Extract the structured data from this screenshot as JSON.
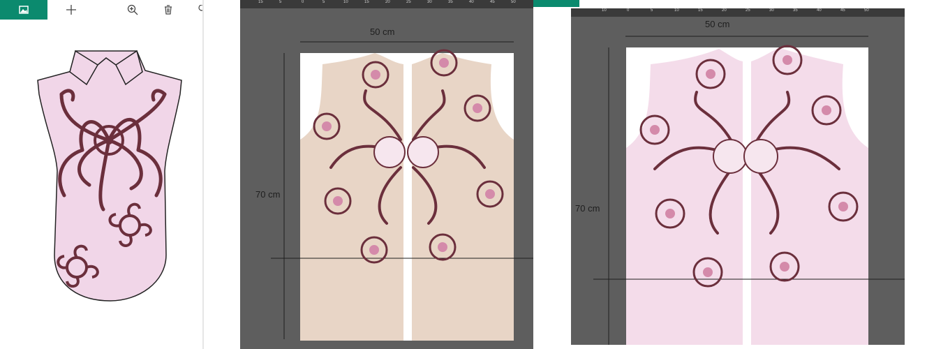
{
  "toolbar": {
    "icons": [
      "image-icon",
      "plus-icon",
      "zoom-in-icon",
      "delete-icon"
    ],
    "accent_color": "#0b8a6e"
  },
  "preview": {
    "garment_fill": "#f1d6e8",
    "motif_color": "#6b2f3c"
  },
  "canvas_beige": {
    "width_label": "50 cm",
    "height_label": "70 cm",
    "fabric_color": "#e8d5c6",
    "ruler_ticks": [
      "15",
      "10",
      "5",
      "0",
      "5",
      "10",
      "15",
      "20",
      "25",
      "30",
      "35",
      "40",
      "45",
      "50",
      "55"
    ]
  },
  "canvas_pink": {
    "width_label": "50 cm",
    "height_label": "70 cm",
    "fabric_color": "#f4dcea",
    "ruler_ticks": [
      "15",
      "10",
      "5",
      "0",
      "5",
      "10",
      "15",
      "20",
      "25",
      "30",
      "35",
      "40",
      "45",
      "50",
      "55"
    ]
  }
}
